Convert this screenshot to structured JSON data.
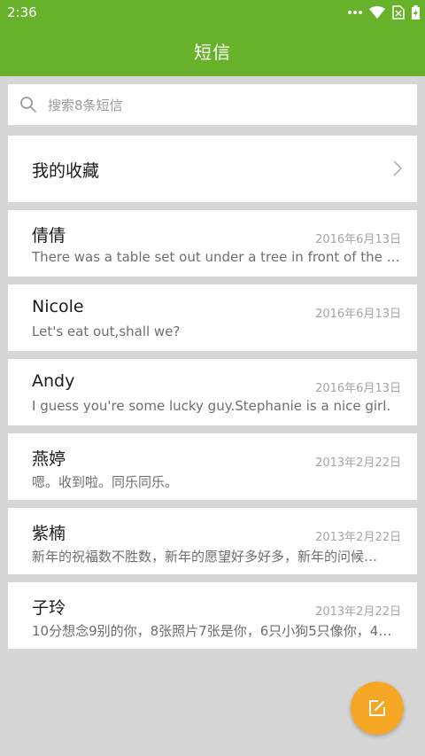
{
  "status_bar": {
    "time": "2:36"
  },
  "app_bar": {
    "title": "短信"
  },
  "search": {
    "placeholder": "搜索8条短信"
  },
  "favorites": {
    "label": "我的收藏"
  },
  "messages": [
    {
      "name": "倩倩",
      "date": "2016年6月13日",
      "preview": "There was a table set out under a tree in front of the house…"
    },
    {
      "name": "Nicole",
      "date": "2016年6月13日",
      "preview": "Let's eat out,shall we?"
    },
    {
      "name": "Andy",
      "date": "2016年6月13日",
      "preview": "I guess you're some lucky guy.Stephanie is a nice girl."
    },
    {
      "name": "燕婷",
      "date": "2013年2月22日",
      "preview": "嗯。收到啦。同乐同乐。"
    },
    {
      "name": "紫楠",
      "date": "2013年2月22日",
      "preview": "新年的祝福数不胜数，新年的愿望好多好多，新年的问候…"
    },
    {
      "name": "子玲",
      "date": "2013年2月22日",
      "preview": "10分想念9别的你，8张照片7张是你，6只小狗5只像你，4…"
    }
  ],
  "colors": {
    "primary": "#68b22b",
    "fab": "#f5a623",
    "background": "#d6d6d6"
  },
  "icons": {
    "search": "search-icon",
    "chevron": "chevron-right-icon",
    "compose": "compose-icon"
  }
}
